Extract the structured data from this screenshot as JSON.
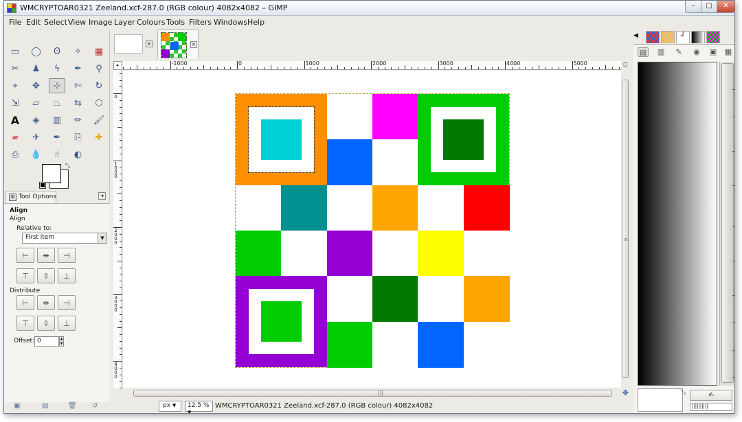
{
  "window": {
    "title": "WMCRYPTOAR0321 Zeeland.xcf-287.0 (RGB colour) 4082x4082 – GIMP",
    "buttons": {
      "minimize": "–",
      "maximize": "□",
      "close": "✕"
    }
  },
  "menu": [
    {
      "label": "File"
    },
    {
      "label": "Edit"
    },
    {
      "label": "Select"
    },
    {
      "label": "View"
    },
    {
      "label": "Image"
    },
    {
      "label": "Layer"
    },
    {
      "label": "Colours"
    },
    {
      "label": "Tools"
    },
    {
      "label": "Filters"
    },
    {
      "label": "Windows"
    },
    {
      "label": "Help"
    }
  ],
  "toolbox": {
    "tools": [
      "rect-select-icon",
      "ellipse-select-icon",
      "free-select-icon",
      "fuzzy-select-icon",
      "by-colour-select-icon",
      "scissors-icon",
      "foreground-select-icon",
      "paths-icon",
      "colour-picker-icon",
      "zoom-icon",
      "measure-icon",
      "move-icon",
      "align-icon",
      "crop-icon",
      "rotate-icon",
      "scale-icon",
      "shear-icon",
      "perspective-icon",
      "flip-icon",
      "cage-icon",
      "text-icon",
      "bucket-fill-icon",
      "blend-icon",
      "pencil-icon",
      "paintbrush-icon",
      "eraser-icon",
      "airbrush-icon",
      "ink-icon",
      "clone-icon",
      "heal-icon",
      "perspective-clone-icon",
      "blur-icon",
      "smudge-icon",
      "dodge-burn-icon"
    ],
    "active_tool": "align-icon"
  },
  "tool_options": {
    "tab_label": "Tool Options",
    "section_title": "Align",
    "subtitle": "Align",
    "relative_to_label": "Relative to:",
    "relative_to_value": "First item",
    "distribute_label": "Distribute",
    "offset_label": "Offset:",
    "offset_value": "0"
  },
  "image_window": {
    "hruler_labels": [
      "-1000",
      "0",
      "1000",
      "2000",
      "3000",
      "4000",
      "5000"
    ],
    "vruler_labels": [
      "0",
      "1000",
      "2000",
      "3000",
      "4000"
    ],
    "unit": "px",
    "zoom": "12.5 %",
    "status": "WMCRYPTOAR0321 Zeeland.xcf-287.0 (RGB colour) 4082x4082"
  },
  "canvas_grid": {
    "rows": 6,
    "cols": 6,
    "colors": [
      [
        "#ff8f00",
        "#ff8f00",
        "#ffffff",
        "#ff00ff",
        "#00cc00",
        "#00cc00"
      ],
      [
        "#ff8f00",
        "#ff8f00",
        "#0066ff",
        "#ffffff",
        "#00cc00",
        "#00cc00"
      ],
      [
        "#ffffff",
        "#009090",
        "#ffffff",
        "#ffa500",
        "#ffffff",
        "#ff0000"
      ],
      [
        "#00cc00",
        "#ffffff",
        "#9400d3",
        "#ffffff",
        "#ffff00",
        "#ffffff"
      ],
      [
        "#9400d3",
        "#9400d3",
        "#ffffff",
        "#007a00",
        "#ffffff",
        "#ffa500"
      ],
      [
        "#9400d3",
        "#9400d3",
        "#00cc00",
        "#ffffff",
        "#0066ff",
        "#ffffff"
      ]
    ],
    "finder_patterns": [
      {
        "name": "top-left",
        "outer": "#ff8f00",
        "inner": "#00cfd6"
      },
      {
        "name": "top-right",
        "outer": "#00cc00",
        "inner": "#007a00"
      },
      {
        "name": "bottom-left",
        "outer": "#9400d3",
        "inner": "#00cc00"
      }
    ]
  },
  "dock": {
    "tab_icons": [
      "patterns-icon",
      "brushes-icon",
      "fonts-icon",
      "gradients-icon",
      "palettes-icon"
    ],
    "panel_icons": [
      "layers-icon",
      "channels-icon",
      "paths-icon",
      "colormap-icon",
      "histogram-icon",
      "undo-icon"
    ]
  }
}
